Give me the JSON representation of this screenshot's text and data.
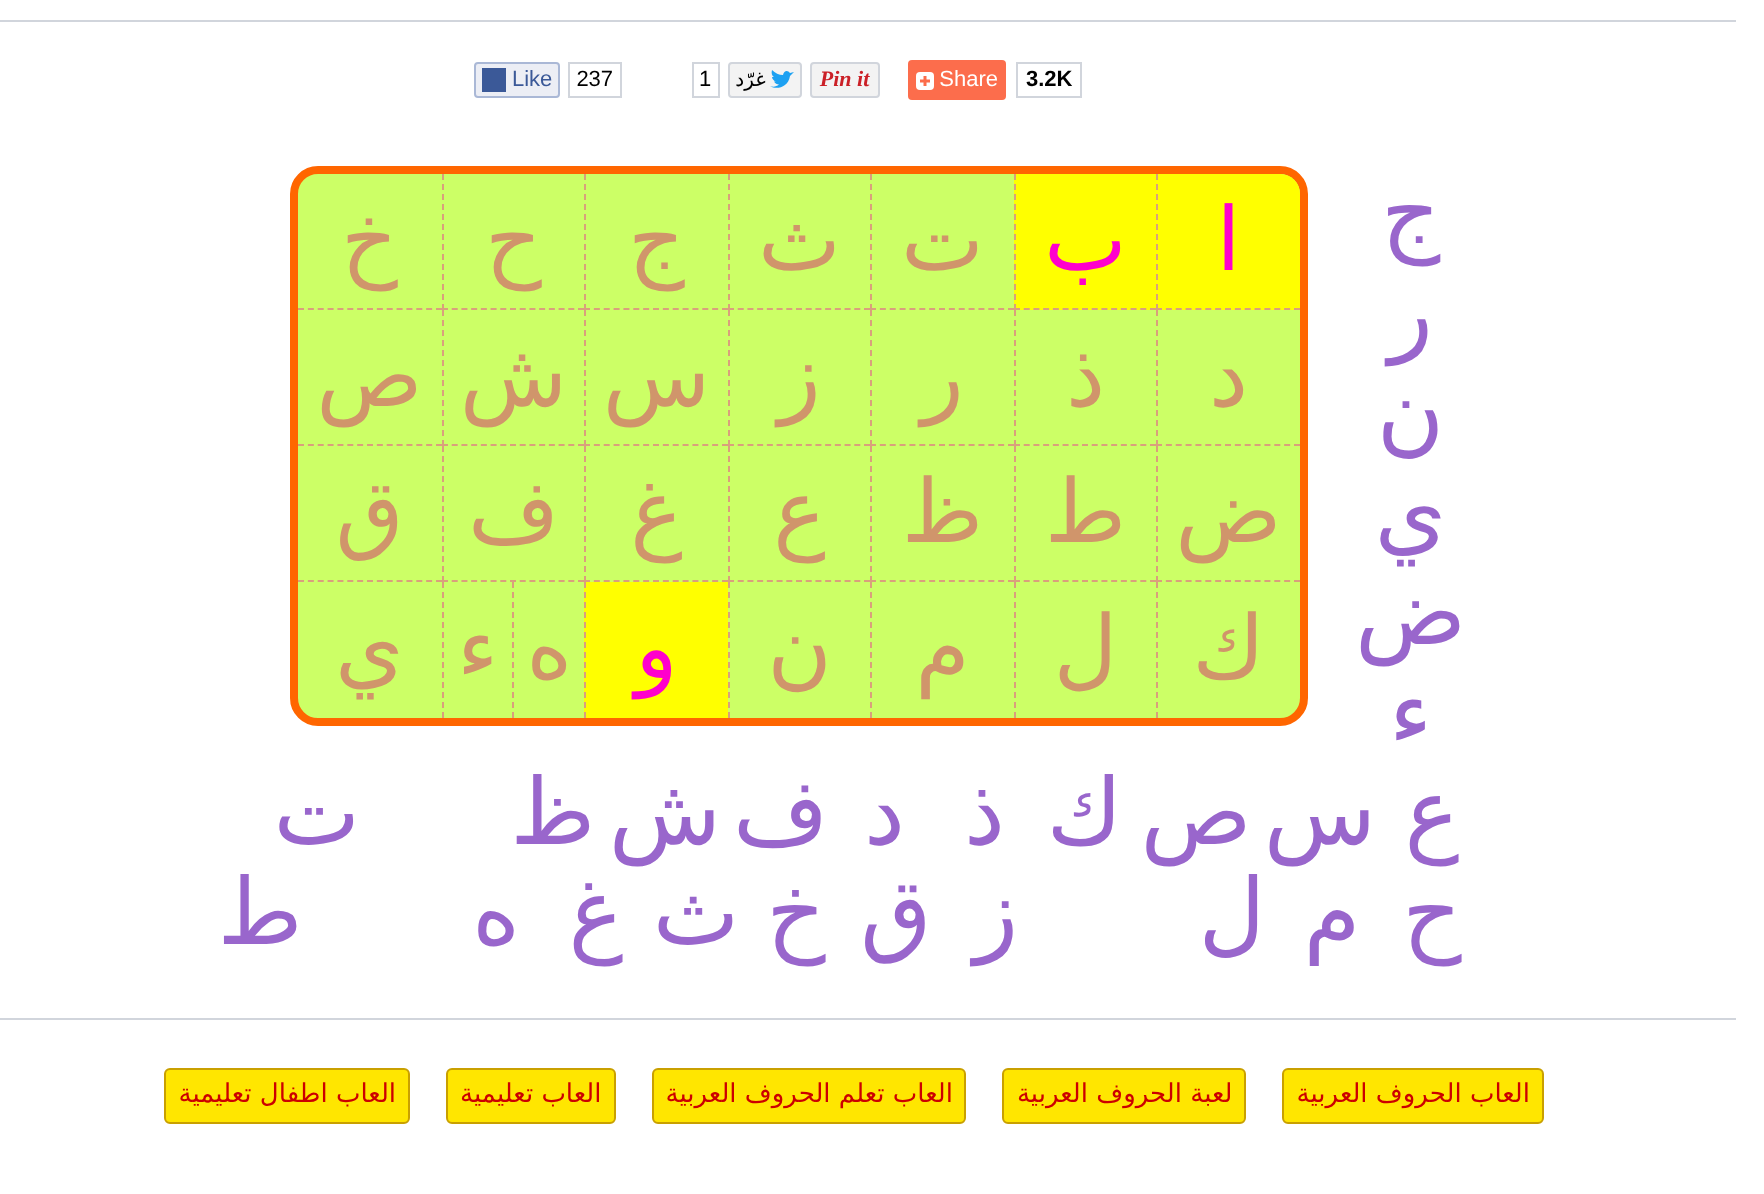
{
  "share_bar": {
    "facebook": {
      "label": "Like",
      "count": "237"
    },
    "twitter": {
      "count": "1",
      "label": "غرّد"
    },
    "pinterest": {
      "label": "Pin it"
    },
    "share": {
      "label": "Share",
      "count": "3.2K"
    }
  },
  "board": {
    "rows": [
      [
        {
          "letter": "ا",
          "kind": "full",
          "highlighted": true
        },
        {
          "letter": "ب",
          "kind": "full",
          "highlighted": true
        },
        {
          "letter": "ت",
          "kind": "full",
          "highlighted": false
        },
        {
          "letter": "ث",
          "kind": "full",
          "highlighted": false
        },
        {
          "letter": "ج",
          "kind": "full",
          "highlighted": false
        },
        {
          "letter": "ح",
          "kind": "full",
          "highlighted": false
        },
        {
          "letter": "خ",
          "kind": "full",
          "highlighted": false
        }
      ],
      [
        {
          "letter": "د",
          "kind": "full",
          "highlighted": false
        },
        {
          "letter": "ذ",
          "kind": "full",
          "highlighted": false
        },
        {
          "letter": "ر",
          "kind": "full",
          "highlighted": false
        },
        {
          "letter": "ز",
          "kind": "full",
          "highlighted": false
        },
        {
          "letter": "س",
          "kind": "full",
          "highlighted": false
        },
        {
          "letter": "ش",
          "kind": "full",
          "highlighted": false
        },
        {
          "letter": "ص",
          "kind": "full",
          "highlighted": false
        }
      ],
      [
        {
          "letter": "ض",
          "kind": "full",
          "highlighted": false
        },
        {
          "letter": "ط",
          "kind": "full",
          "highlighted": false
        },
        {
          "letter": "ظ",
          "kind": "full",
          "highlighted": false
        },
        {
          "letter": "ع",
          "kind": "full",
          "highlighted": false
        },
        {
          "letter": "غ",
          "kind": "full",
          "highlighted": false
        },
        {
          "letter": "ف",
          "kind": "full",
          "highlighted": false
        },
        {
          "letter": "ق",
          "kind": "full",
          "highlighted": false
        }
      ],
      [
        {
          "letter": "ك",
          "kind": "full",
          "highlighted": false
        },
        {
          "letter": "ل",
          "kind": "full",
          "highlighted": false
        },
        {
          "letter": "م",
          "kind": "full",
          "highlighted": false
        },
        {
          "letter": "ن",
          "kind": "full",
          "highlighted": false
        },
        {
          "letter": "و",
          "kind": "full",
          "highlighted": true
        },
        {
          "kind": "split",
          "parts": [
            {
              "letter": "ه",
              "highlighted": false
            },
            {
              "letter": "ء",
              "highlighted": false
            }
          ]
        },
        {
          "letter": "ي",
          "kind": "full",
          "highlighted": false
        }
      ]
    ]
  },
  "side_pieces": [
    "ج",
    "ر",
    "ن",
    "ي",
    "ض",
    "ء"
  ],
  "bottom_pieces": [
    [
      [
        "ع",
        "س",
        "ص",
        "ك",
        "ذ",
        "د",
        "ف",
        "ش",
        "ظ"
      ],
      [
        "ت"
      ]
    ],
    [
      [
        "ح",
        "م",
        "ل"
      ],
      [
        "ز",
        "ق",
        "خ",
        "ث",
        "غ",
        "ه"
      ],
      [
        "ط"
      ]
    ]
  ],
  "links": [
    "العاب الحروف العربية",
    "لعبة الحروف العربية",
    "العاب تعلم الحروف العربية",
    "العاب تعليمية",
    "العاب اطفال تعليمية"
  ]
}
